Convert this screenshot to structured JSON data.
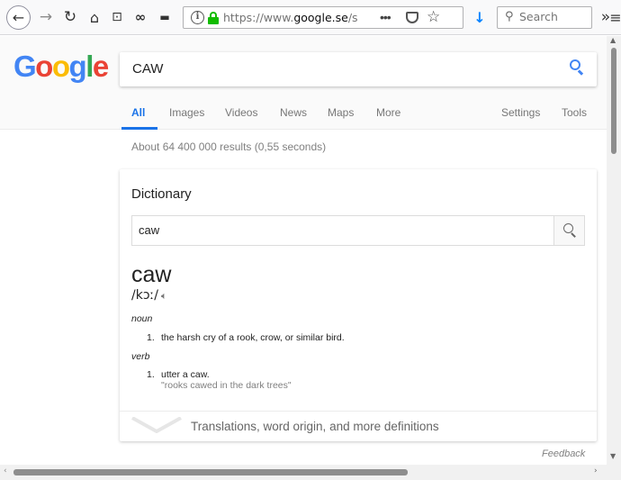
{
  "browser": {
    "url_prefix": "https://www.",
    "url_domain": "google.se",
    "url_suffix": "/search",
    "url_dots": "•••",
    "search_placeholder": "Search",
    "icons": [
      "back-icon",
      "forward-icon",
      "reload-icon",
      "home-icon",
      "sync-icon",
      "extension-icon",
      "extension-icon",
      "info-icon",
      "lock-icon",
      "page-actions-icon",
      "pocket-icon",
      "star-icon",
      "download-icon",
      "search-icon",
      "overflow-icon",
      "menu-icon"
    ]
  },
  "google": {
    "logo_letters": [
      {
        "char": "G",
        "color": "#4285f4"
      },
      {
        "char": "o",
        "color": "#ea4335"
      },
      {
        "char": "o",
        "color": "#fbbc05"
      },
      {
        "char": "g",
        "color": "#4285f4"
      },
      {
        "char": "l",
        "color": "#34a853"
      },
      {
        "char": "e",
        "color": "#ea4335"
      }
    ],
    "query": "CAW",
    "tabs": [
      {
        "label": "All",
        "active": true
      },
      {
        "label": "Images"
      },
      {
        "label": "Videos"
      },
      {
        "label": "News"
      },
      {
        "label": "Maps"
      },
      {
        "label": "More"
      },
      {
        "label": "Settings"
      },
      {
        "label": "Tools"
      }
    ],
    "result_stats": "About 64 400 000 results (0,55 seconds)",
    "accent_color": "#1a73e8"
  },
  "dictionary": {
    "title": "Dictionary",
    "search_value": "caw",
    "headword": "caw",
    "phonetic": "/kɔː/",
    "senses": [
      {
        "pos": "noun",
        "definitions": [
          {
            "num": "1.",
            "text": "the harsh cry of a rook, crow, or similar bird."
          }
        ]
      },
      {
        "pos": "verb",
        "definitions": [
          {
            "num": "1.",
            "text": "utter a caw.",
            "example": "\"rooks cawed in the dark trees\""
          }
        ]
      }
    ],
    "more_label": "Translations, word origin, and more definitions"
  },
  "feedback": "Feedback"
}
